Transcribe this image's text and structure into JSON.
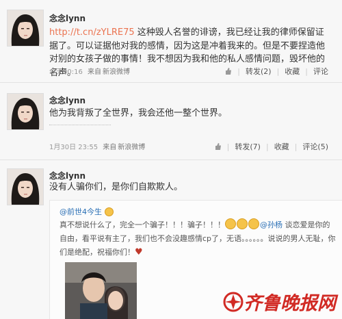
{
  "posts": [
    {
      "username": "念念lynn",
      "link_text": "http://t.cn/zYLRE75",
      "text": " 这种毁人名誉的诽谤，我已经让我的律师保留证据了。可以证据他对我的感情，因为这是冲着我来的。但是不要捏造他对别的女孩子做的事情！我不想因为我和他的私人感情问题，毁坏他的名声。",
      "time": "今天00:16",
      "source_prefix": "来自",
      "source": "新浪微博",
      "forward_label": "转发(2)",
      "collect_label": "收藏",
      "comment_label": "评论"
    },
    {
      "username": "念念lynn",
      "text": "他为我背叛了全世界，我会还他一整个世界。",
      "time": "1月30日 23:55",
      "source_prefix": "来自",
      "source": "新浪微博",
      "forward_label": "转发(7)",
      "collect_label": "收藏",
      "comment_label": "评论(5)"
    },
    {
      "username": "念念lynn",
      "text": "没有人骗你们，是你们自欺欺人。",
      "quote": {
        "user": "@前世4今生",
        "text_1": "真不想说什么了，完全一个骗子！！！骗子！！！",
        "mention": "@孙杨",
        "text_2": " 谈恋爱是你的自由，看平说有主了，我们也不会没趣感情cp了，无语。。。。。。说说的男人无耻，你们是绝配，祝福你们！"
      }
    }
  ],
  "watermark": "齐鲁晚报网",
  "colors": {
    "link": "#eb7350",
    "mention": "#2a6fb5",
    "watermark": "#d12a24"
  }
}
